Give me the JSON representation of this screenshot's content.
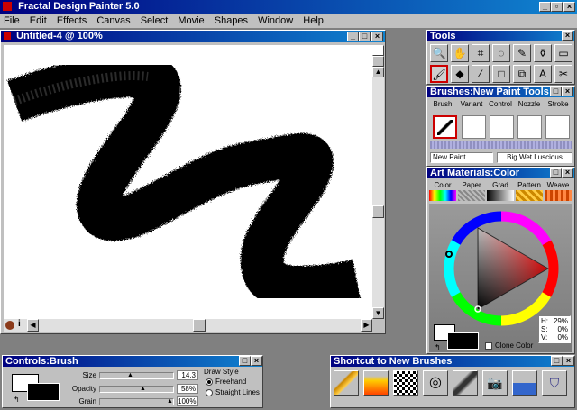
{
  "app": {
    "title": "Fractal Design Painter 5.0",
    "menu": [
      "File",
      "Edit",
      "Effects",
      "Canvas",
      "Select",
      "Movie",
      "Shapes",
      "Window",
      "Help"
    ]
  },
  "document": {
    "title": "Untitled-4 @ 100%"
  },
  "tools_palette": {
    "title": "Tools",
    "tools": [
      "magnifier-icon",
      "grabber-icon",
      "crop-icon",
      "lasso-icon",
      "pen-icon",
      "bucket-icon",
      "rect-select-icon",
      "brush-icon",
      "paint-bucket-icon",
      "dropper-icon",
      "rectangle-icon",
      "layer-adjust-icon",
      "text-icon",
      "shape-select-icon",
      "scissors-icon"
    ]
  },
  "brushes_palette": {
    "title": "Brushes:New Paint Tools",
    "tabs": [
      "Brush",
      "Variant",
      "Control",
      "Nozzle",
      "Stroke"
    ],
    "brush_name": "New Paint ...",
    "variant_name": "Big Wet Luscious"
  },
  "art_materials": {
    "title": "Art Materials:Color",
    "tabs": [
      "Color",
      "Paper",
      "Grad",
      "Pattern",
      "Weave"
    ],
    "hsv": {
      "h_label": "H:",
      "h": "29%",
      "s_label": "S:",
      "s": "0%",
      "v_label": "V:",
      "v": "0%"
    },
    "clone_color_label": "Clone Color"
  },
  "controls": {
    "title": "Controls:Brush",
    "size_label": "Size",
    "size_value": "14.3",
    "opacity_label": "Opacity",
    "opacity_value": "58%",
    "grain_label": "Grain",
    "grain_value": "100%",
    "draw_style_label": "Draw Style",
    "freehand_label": "Freehand",
    "straight_lines_label": "Straight Lines"
  },
  "shortcut": {
    "title": "Shortcut to New Brushes",
    "icons": [
      "pencil-brush-icon",
      "fire-brush-icon",
      "pattern-brush-icon",
      "spray-brush-icon",
      "marker-brush-icon",
      "camera-brush-icon",
      "water-brush-icon",
      "badge-brush-icon"
    ]
  }
}
